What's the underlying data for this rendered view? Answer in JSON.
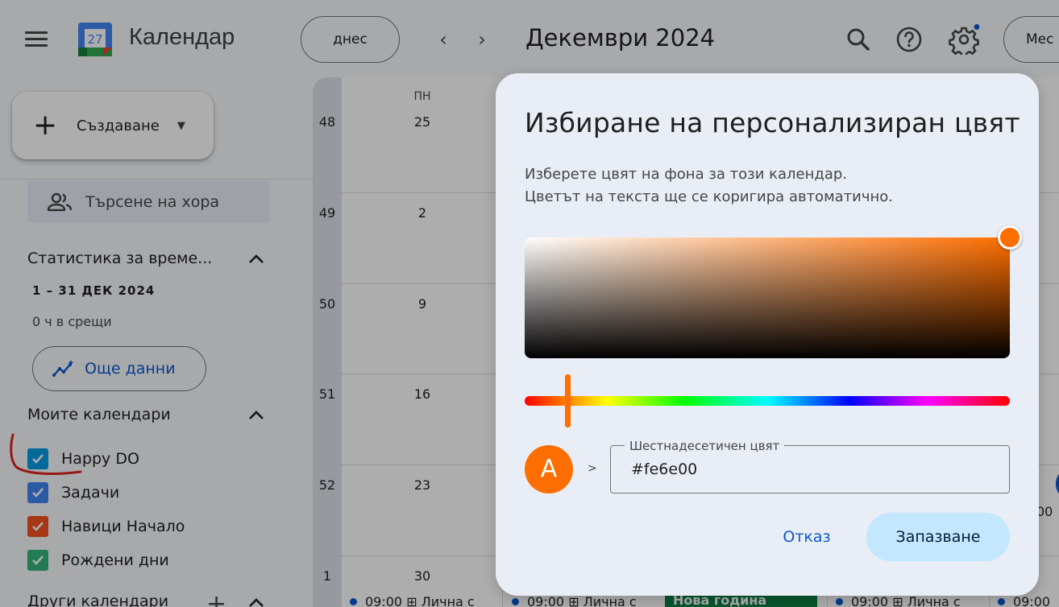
{
  "header": {
    "app_title": "Календар",
    "logo_day": "27",
    "today_label": "днес",
    "prev_label": "‹",
    "next_label": "›",
    "month_title": "Декември 2024",
    "view_label": "Мес"
  },
  "sidebar": {
    "create_label": "Създаване",
    "people_search_label": "Търсене на хора",
    "stats_title": "Статистика за време...",
    "stats_range": "1 – 31 ДЕК 2024",
    "stats_meetings": "0 ч в срещи",
    "more_data_label": "Още данни",
    "my_calendars_title": "Моите календари",
    "my_calendars": [
      {
        "label": "Happy DO",
        "color": "#039be5"
      },
      {
        "label": "Задачи",
        "color": "#4285f4"
      },
      {
        "label": "Навици Начало",
        "color": "#f4511e"
      },
      {
        "label": "Рождени дни",
        "color": "#33b679"
      }
    ],
    "other_calendars_title": "Други календари"
  },
  "grid": {
    "dow_header": "ПН",
    "weeks": [
      {
        "week": "48",
        "day": "25"
      },
      {
        "week": "49",
        "day": "2"
      },
      {
        "week": "50",
        "day": "9"
      },
      {
        "week": "51",
        "day": "16"
      },
      {
        "week": "52",
        "day": "23"
      },
      {
        "week": "1",
        "day": "30"
      }
    ],
    "events": {
      "e1": "09:00 ⊞ Лична с",
      "e2": "09:00 ⊞ Лична с",
      "chip": "Нова година",
      "e3": "09:00 ⊞ Лична с",
      "e4": "09:00"
    },
    "partial_number": "00"
  },
  "dialog": {
    "title": "Избиране на персонализиран цвят",
    "desc_line1": "Изберете цвят на фона за този календар.",
    "desc_line2": "Цветът на текста ще се коригира автоматично.",
    "preview_letter": "A",
    "preview_arrow": ">",
    "hex_label": "Шестнадесетичен цвят",
    "hex_value": "#fe6e00",
    "cancel_label": "Отказ",
    "save_label": "Запазване",
    "selected_color": "#fe6e00"
  }
}
